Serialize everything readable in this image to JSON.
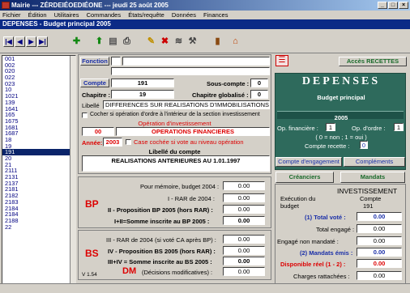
{
  "window": {
    "title": "Mairie --- ZÉRDEIÉOEDIÉONE --- jeudi 25 août 2005",
    "min": "_",
    "max": "□",
    "close": "×"
  },
  "menu": [
    "Fichier",
    "Édition",
    "Utilitaires",
    "Commandes",
    "États/requête",
    "Données",
    "Finances"
  ],
  "form_title": "DEPENSES - Budget principal 2005",
  "nav": [
    "|◀",
    "◀",
    "▶",
    "▶|"
  ],
  "list_items": [
    "001",
    "002",
    "020",
    "022",
    "023",
    "10",
    "1021",
    "139",
    "1641",
    "165",
    "1675",
    "1681",
    "1687",
    "18",
    "19",
    "191",
    "20",
    "21",
    "2111",
    "2131",
    "2137",
    "2181",
    "2182",
    "2183",
    "2184",
    "2184",
    "2188",
    "22"
  ],
  "selected_item": "191",
  "fonction": {
    "label": "Fonction",
    "v1": "",
    "v2": ""
  },
  "compte": {
    "label": "Compte",
    "value": "191",
    "sous_label": "Sous-compte :",
    "sous_value": "0"
  },
  "chapitre": {
    "label": "Chapitre :",
    "value": "19",
    "glob_label": "Chapitre globalisé :",
    "glob_value": "0"
  },
  "libelle": {
    "label": "Libellé",
    "value": "DIFFERENCES SUR REALISATIONS D'IMMOBILISATIONS"
  },
  "ordre_checkbox": "Cocher si opération d'ordre à l'intérieur de la section investissement",
  "operation": {
    "title": "Opération d'investissement",
    "code": "00",
    "name": "OPERATIONS FINANCIERES"
  },
  "annee": {
    "label": "Année:",
    "value": "2003",
    "checkbox": "Case cochée si vote au niveau opération"
  },
  "libelle_compte": {
    "title": "Libellé du compte",
    "value": "REALISATIONS ANTERIEURES AU 1.01.1997"
  },
  "bp": {
    "code": "BP",
    "memo_label": "Pour mémoire, budget 2004 :",
    "memo_value": "0.00",
    "rar_label": "I - RAR de 2004 :",
    "rar_value": "0.00",
    "prop_label": "II - Proposition BP 2005 (hors RAR) :",
    "prop_value": "0.00",
    "sum_label": "I+II=Somme inscrite au BP 2005 :",
    "sum_value": "0.00"
  },
  "bs": {
    "code": "BS",
    "rar_label": "III - RAR de 2004 (si voté CA après BP) :",
    "rar_value": "0.00",
    "prop_label": "IV - Proposition BS 2005 (hors RAR) :",
    "prop_value": "0.00",
    "sum_label": "III+IV = Somme inscrite au BS 2005 :",
    "sum_value": "0.00",
    "dm_code": "DM",
    "dm_label": "(Décisions modificatives) :",
    "dm_value": "0.00",
    "version": "V 1.54"
  },
  "right": {
    "acces_btn": "Accès RECETTES",
    "depenses": "DEPENSES",
    "budget": "Budget principal",
    "year": "2005",
    "op_fin_label": "Op. financière :",
    "op_fin_value": "1",
    "op_ordre_label": "Op. d'ordre :",
    "op_ordre_value": "1",
    "flags_note": "( 0 = non ; 1 = oui )",
    "compte_recette": "Compte recette :",
    "compte_recette_value": "0",
    "tab_engagement": "Compte d'engagement",
    "tab_complements": "Compléments"
  },
  "lower_right": {
    "btn_creanciers": "Créanciers",
    "btn_mandats": "Mandats",
    "section": "INVESTISSEMENT",
    "compte_label": "Compte",
    "compte_value": "191",
    "exec_label": "Exécution du budget",
    "total_vote_label": "(1) Total voté :",
    "total_vote": "0.00",
    "total_engage_label": "Total engagé :",
    "total_engage": "0.00",
    "engage_non_label": "Engagé non mandaté :",
    "engage_non": "0.00",
    "mandats_label": "(2) Mandats émis :",
    "mandats": "0.00",
    "dispo_label": "Disponible réel (1 - 2) :",
    "dispo": "0.00",
    "charges_label": "Charges rattachées :",
    "charges": "0.00"
  }
}
